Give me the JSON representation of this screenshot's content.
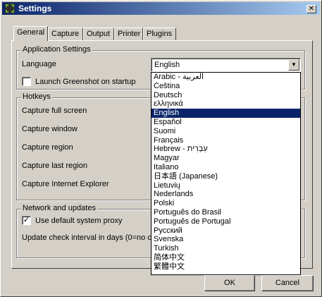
{
  "window": {
    "title": "Settings"
  },
  "tabs": [
    "General",
    "Capture",
    "Output",
    "Printer",
    "Plugins"
  ],
  "application_settings": {
    "title": "Application Settings",
    "language_label": "Language",
    "language_value": "English",
    "launch_startup_label": "Launch Greenshot on startup",
    "launch_startup_checked": false
  },
  "hotkeys": {
    "title": "Hotkeys",
    "items": [
      "Capture full screen",
      "Capture window",
      "Capture region",
      "Capture last region",
      "Capture Internet Explorer"
    ]
  },
  "network": {
    "title": "Network and updates",
    "proxy_label": "Use default system proxy",
    "proxy_checked": true,
    "update_label": "Update check interval in days (0=no ch"
  },
  "languages": [
    "Arabic - العربية",
    "Čeština",
    "Deutsch",
    "ελληνικά",
    "English",
    "Español",
    "Suomi",
    "Français",
    "Hebrew - עִבְרִית",
    "Magyar",
    "Italiano",
    "日本語 (Japanese)",
    "Lietuvių",
    "Nederlands",
    "Polski",
    "Português do Brasil",
    "Português de Portugal",
    "Русский",
    "Svenska",
    "Turkish",
    "简体中文",
    "繁體中文"
  ],
  "selected_language_index": 4,
  "buttons": {
    "ok": "OK",
    "cancel": "Cancel"
  },
  "icons": {
    "app": "greenshot-icon",
    "close": "close-icon",
    "dropdown": "chevron-down-icon",
    "check": "check-icon"
  }
}
